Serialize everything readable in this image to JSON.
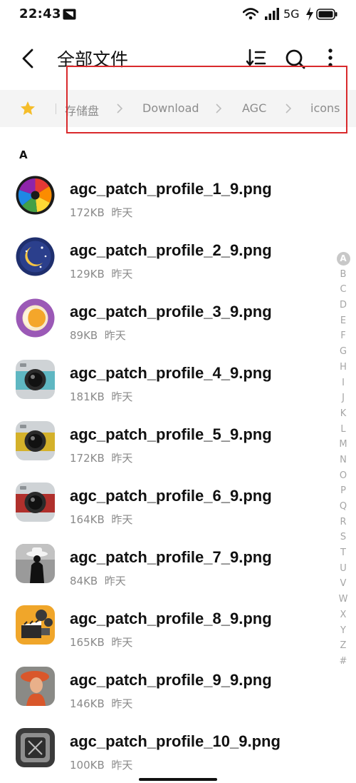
{
  "status_bar": {
    "time": "22:43",
    "network": "5G"
  },
  "header": {
    "title": "全部文件"
  },
  "breadcrumb": {
    "items": [
      "存储盘",
      "Download",
      "AGC",
      "icons"
    ]
  },
  "section": {
    "letter": "A"
  },
  "files": [
    {
      "name": "agc_patch_profile_1_9.png",
      "size": "172KB",
      "date": "昨天",
      "icon": "color-wheel-icon"
    },
    {
      "name": "agc_patch_profile_2_9.png",
      "size": "129KB",
      "date": "昨天",
      "icon": "night-moon-icon"
    },
    {
      "name": "agc_patch_profile_3_9.png",
      "size": "89KB",
      "date": "昨天",
      "icon": "sun-moon-icon"
    },
    {
      "name": "agc_patch_profile_4_9.png",
      "size": "181KB",
      "date": "昨天",
      "icon": "camera-teal-icon"
    },
    {
      "name": "agc_patch_profile_5_9.png",
      "size": "172KB",
      "date": "昨天",
      "icon": "camera-yellow-icon"
    },
    {
      "name": "agc_patch_profile_6_9.png",
      "size": "164KB",
      "date": "昨天",
      "icon": "camera-red-icon"
    },
    {
      "name": "agc_patch_profile_7_9.png",
      "size": "84KB",
      "date": "昨天",
      "icon": "man-in-hat-icon"
    },
    {
      "name": "agc_patch_profile_8_9.png",
      "size": "165KB",
      "date": "昨天",
      "icon": "film-clapper-icon"
    },
    {
      "name": "agc_patch_profile_9_9.png",
      "size": "146KB",
      "date": "昨天",
      "icon": "woman-portrait-icon"
    },
    {
      "name": "agc_patch_profile_10_9.png",
      "size": "100KB",
      "date": "昨天",
      "icon": "metal-square-icon"
    }
  ],
  "alphabet_index": [
    "A",
    "B",
    "C",
    "D",
    "E",
    "F",
    "G",
    "H",
    "I",
    "J",
    "K",
    "L",
    "M",
    "N",
    "O",
    "P",
    "Q",
    "R",
    "S",
    "T",
    "U",
    "V",
    "W",
    "X",
    "Y",
    "Z",
    "#"
  ],
  "alphabet_active": "A",
  "colors": {
    "highlight_border": "#d9292c",
    "star": "#f5bd2a",
    "breadcrumb_bg": "#f4f4f4"
  }
}
